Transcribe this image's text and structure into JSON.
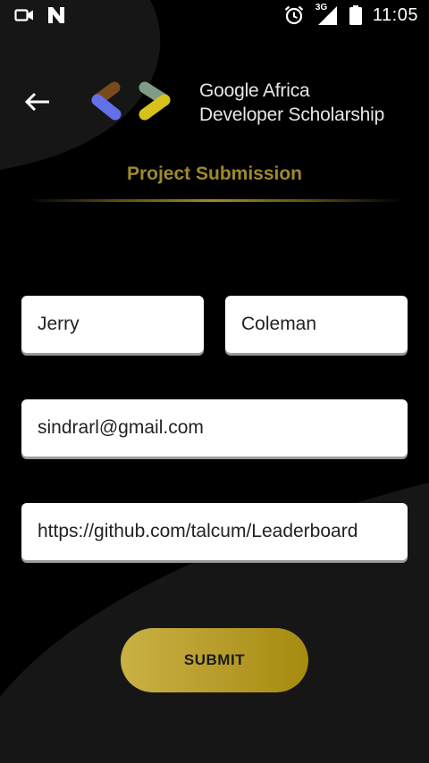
{
  "status_bar": {
    "time": "11:05",
    "network": "3G",
    "icons": [
      "video-camera-icon",
      "n-notification-icon",
      "alarm-icon",
      "signal-icon",
      "battery-icon"
    ]
  },
  "header": {
    "back_icon": "arrow-left-icon",
    "logo_line1": "Google Africa",
    "logo_line2": "Developer Scholarship"
  },
  "page": {
    "title": "Project Submission"
  },
  "form": {
    "first_name": "Jerry",
    "last_name": "Coleman",
    "email": "sindrarl@gmail.com",
    "github_link": "https://github.com/talcum/Leaderboard"
  },
  "submit_label": "SUBMIT",
  "colors": {
    "accent": "#9e8a2c",
    "button_start": "#c9b144",
    "button_end": "#a68b0e",
    "background": "#000000"
  }
}
